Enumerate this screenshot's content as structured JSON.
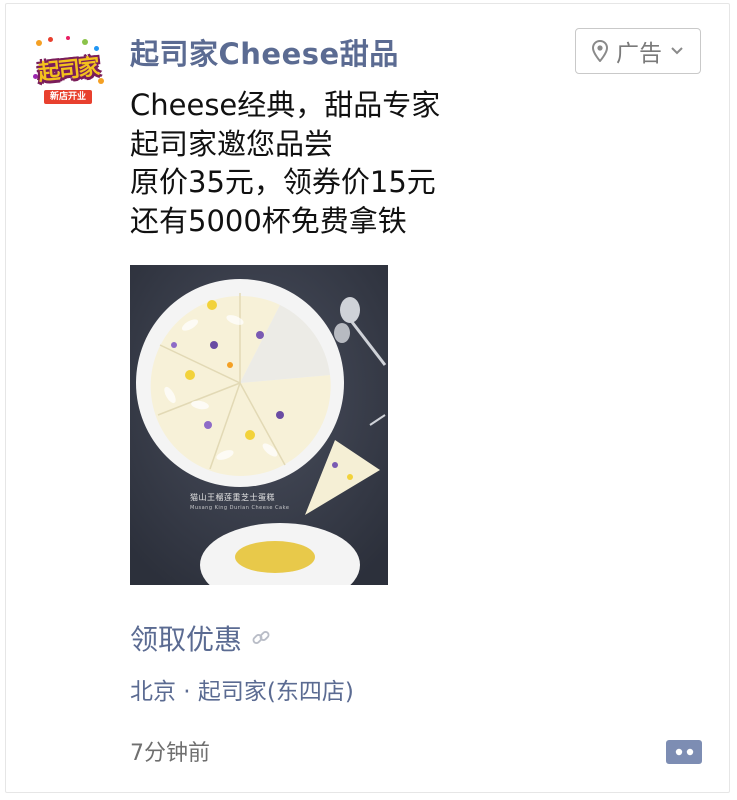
{
  "header": {
    "brand_name": "起司家Cheese甜品",
    "ad_tag": {
      "label": "广告",
      "icon": "location-pin-icon",
      "chevron": "chevron-down-icon"
    }
  },
  "avatar": {
    "logo_text": "起司家",
    "banner_text": "新店开业"
  },
  "ad_copy": {
    "lines": [
      "Cheese经典，甜品专家",
      "起司家邀您品尝",
      "原价35元，领券价15元",
      "还有5000杯免费拿铁"
    ]
  },
  "ad_image": {
    "caption_line1": "猫山王榴莲重芝士蛋糕",
    "caption_line2": "Musang King Durian Cheese Cake"
  },
  "cta": {
    "label": "领取优惠",
    "icon": "link-icon"
  },
  "location": {
    "text": "北京 · 起司家(东四店)"
  },
  "timestamp": {
    "text": "7分钟前"
  },
  "actions": {
    "comment_icon": "comment-icon"
  },
  "colors": {
    "link_blue": "#5b6b92",
    "text_dark": "#111111",
    "muted": "#7a7a7a",
    "image_bg": "#3a3f4c"
  }
}
